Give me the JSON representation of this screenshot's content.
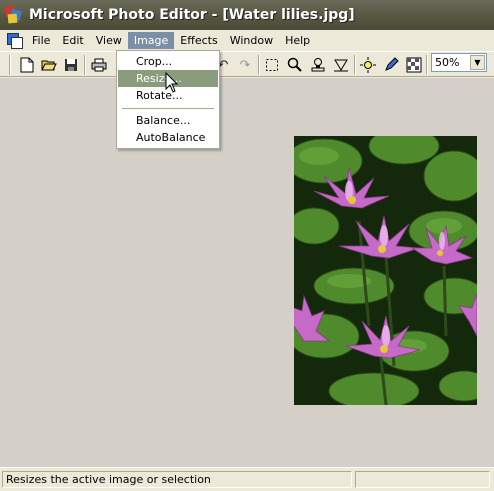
{
  "window": {
    "title": "Microsoft Photo Editor - [Water lilies.jpg]"
  },
  "menubar": {
    "items": [
      {
        "label": "File",
        "name": "menu-file"
      },
      {
        "label": "Edit",
        "name": "menu-edit"
      },
      {
        "label": "View",
        "name": "menu-view"
      },
      {
        "label": "Image",
        "name": "menu-image",
        "active": true
      },
      {
        "label": "Effects",
        "name": "menu-effects"
      },
      {
        "label": "Window",
        "name": "menu-window"
      },
      {
        "label": "Help",
        "name": "menu-help"
      }
    ]
  },
  "image_menu": {
    "items": [
      "Crop...",
      "Resize...",
      "Rotate...",
      "Balance...",
      "AutoBalance"
    ],
    "highlighted": "Resize..."
  },
  "toolbar": {
    "zoom_value": "50%",
    "icons": [
      "new-icon",
      "open-icon",
      "save-icon",
      "print-icon",
      "undo-icon",
      "redo-icon",
      "select-icon",
      "zoom-icon",
      "stamp-icon",
      "cutout-icon",
      "effects-icon",
      "pen-icon",
      "transparent-icon"
    ]
  },
  "statusbar": {
    "message": "Resizes the active image or selection"
  },
  "colors": {
    "title_bar": "#55553f",
    "menu_highlight": "#8b9c7d",
    "workspace": "#D4D0C8"
  }
}
